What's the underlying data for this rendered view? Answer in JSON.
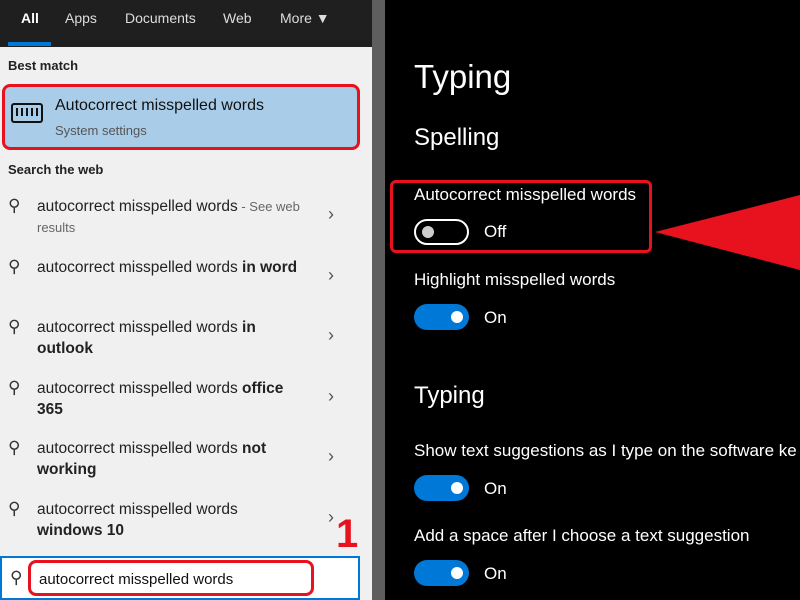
{
  "search_panel": {
    "tabs": [
      {
        "label": "All"
      },
      {
        "label": "Apps"
      },
      {
        "label": "Documents"
      },
      {
        "label": "Web"
      },
      {
        "label": "More ▼"
      }
    ],
    "best_match_heading": "Best match",
    "best_match": {
      "title": "Autocorrect misspelled words",
      "subtitle": "System settings",
      "icon": "keyboard-icon"
    },
    "web_heading": "Search the web",
    "web_results": [
      {
        "text": "autocorrect misspelled words",
        "bold": "",
        "suffix": " - See web results"
      },
      {
        "text": "autocorrect misspelled words ",
        "bold": "in word",
        "suffix": ""
      },
      {
        "text": "autocorrect misspelled words ",
        "bold": "in outlook",
        "suffix": ""
      },
      {
        "text": "autocorrect misspelled words ",
        "bold": "office 365",
        "suffix": ""
      },
      {
        "text": "autocorrect misspelled words ",
        "bold": "not working",
        "suffix": ""
      },
      {
        "text": "autocorrect misspelled words ",
        "bold": "windows 10",
        "suffix": ""
      }
    ],
    "annotation_number": "1",
    "search_value": "autocorrect misspelled words"
  },
  "settings": {
    "title": "Typing",
    "spelling_heading": "Spelling",
    "autocorrect": {
      "label": "Autocorrect misspelled words",
      "state": "Off",
      "on": false
    },
    "highlight": {
      "label": "Highlight misspelled words",
      "state": "On",
      "on": true
    },
    "typing_heading": "Typing",
    "suggestions": {
      "label": "Show text suggestions as I type on the software ke",
      "state": "On",
      "on": true
    },
    "space": {
      "label": "Add a space after I choose a text suggestion",
      "state": "On",
      "on": true
    }
  },
  "colors": {
    "accent": "#0078d7",
    "annotation": "#e8121e",
    "highlight": "#a9cde9"
  }
}
